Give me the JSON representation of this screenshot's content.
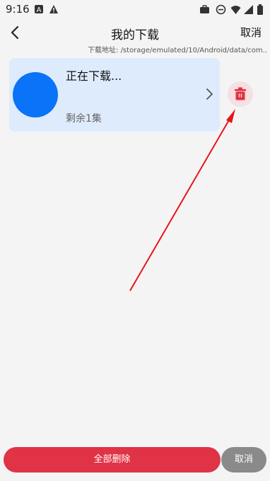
{
  "status_bar": {
    "time": "9:16",
    "left_icons": [
      "a-notification-icon",
      "warning-icon"
    ],
    "right_icons": [
      "briefcase-icon",
      "do-not-disturb-icon",
      "wifi-icon",
      "signal-icon",
      "battery-icon"
    ]
  },
  "header": {
    "title": "我的下载",
    "cancel_label": "取消"
  },
  "download_path": {
    "label": "下载地址:",
    "value": "/storage/emulated/10/Android/data/com.."
  },
  "download_item": {
    "title": "正在下载...",
    "subtitle": "剩余1集",
    "avatar_color": "#0a73f7"
  },
  "footer": {
    "delete_all_label": "全部删除",
    "cancel_label": "取消"
  },
  "colors": {
    "card_bg": "#deebfc",
    "delete_red": "#e03346",
    "annotation_red": "#e8141c"
  }
}
